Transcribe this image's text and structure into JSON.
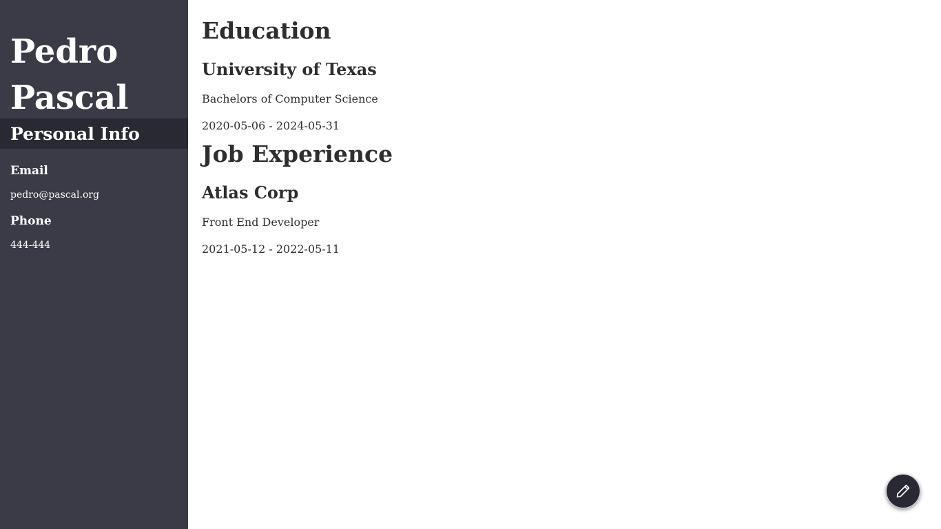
{
  "profile": {
    "name_first": "Pedro",
    "name_last": "Pascal"
  },
  "personal_info": {
    "heading": "Personal Info",
    "email_label": "Email",
    "email_value": "pedro@pascal.org",
    "phone_label": "Phone",
    "phone_value": "444-444"
  },
  "education": {
    "heading": "Education",
    "items": [
      {
        "institution": "University of Texas",
        "degree": "Bachelors of Computer Science",
        "dates": "2020-05-06 - 2024-05-31"
      }
    ]
  },
  "job_experience": {
    "heading": "Job Experience",
    "items": [
      {
        "company": "Atlas Corp",
        "title": "Front End Developer",
        "dates": "2021-05-12 - 2022-05-11"
      }
    ]
  },
  "edit_button": {
    "icon": "pencil-icon"
  },
  "colors": {
    "sidebar_bg": "#3a3b47",
    "sidebar_section_bg": "#282933",
    "main_text": "#2e2e2e",
    "fab_bg": "#282933"
  }
}
